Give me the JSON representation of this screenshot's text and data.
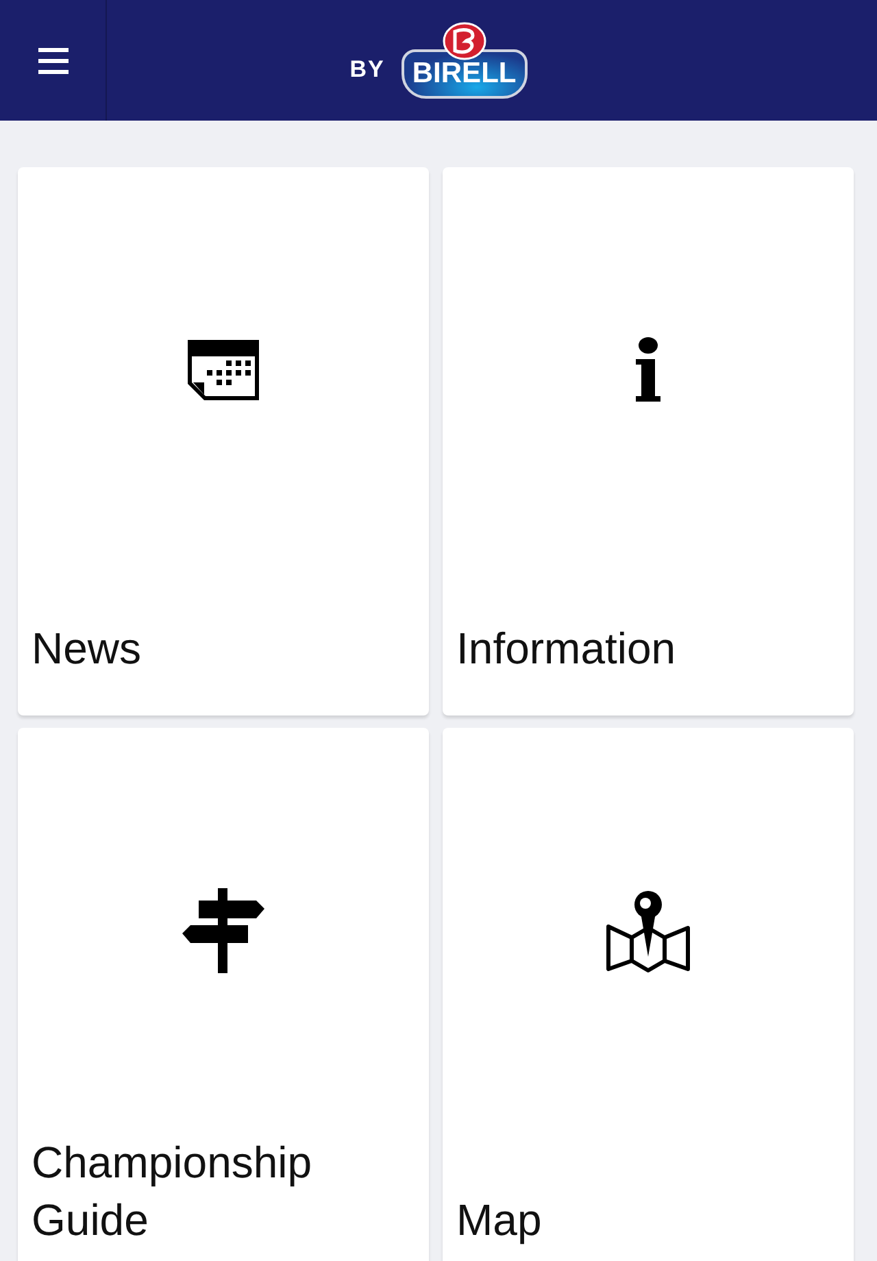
{
  "header": {
    "logo_prefix": "BY",
    "logo_name": "BIRELL"
  },
  "tiles": [
    {
      "label": "News",
      "kind": "calendar"
    },
    {
      "label": "Information",
      "kind": "info"
    },
    {
      "label": "Championship Guide",
      "kind": "signpost"
    },
    {
      "label": "Map",
      "kind": "map"
    }
  ]
}
